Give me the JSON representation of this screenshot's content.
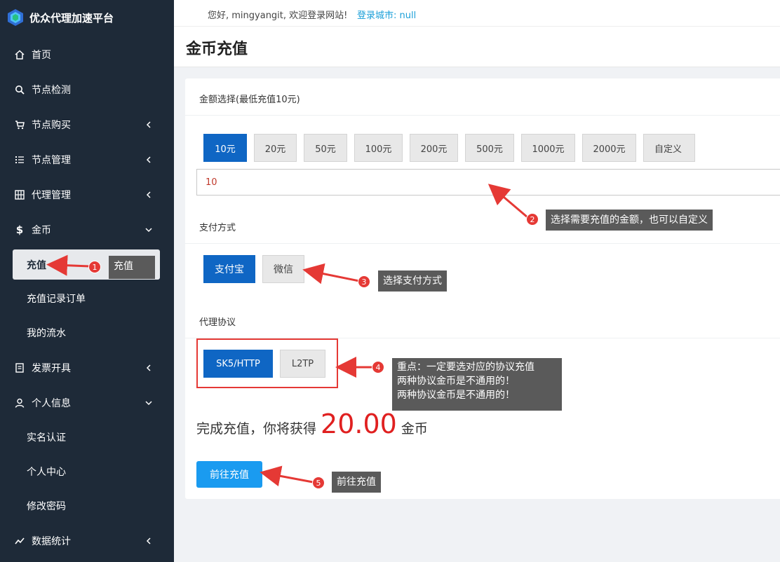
{
  "brand": {
    "title": "优众代理加速平台",
    "accent": "#1e2a38"
  },
  "sidebar": {
    "items": [
      {
        "label": "首页",
        "icon": "home-icon"
      },
      {
        "label": "节点检测",
        "icon": "search-icon"
      },
      {
        "label": "节点购买",
        "icon": "cart-icon"
      },
      {
        "label": "节点管理",
        "icon": "list-icon"
      },
      {
        "label": "代理管理",
        "icon": "grid-icon"
      },
      {
        "label": "金币",
        "icon": "dollar-icon"
      },
      {
        "label": "发票开具",
        "icon": "invoice-icon"
      },
      {
        "label": "个人信息",
        "icon": "user-icon"
      },
      {
        "label": "数据统计",
        "icon": "chart-icon"
      }
    ],
    "coin_sub": [
      "充值",
      "充值记录订单",
      "我的流水"
    ],
    "profile_sub": [
      "实名认证",
      "个人中心",
      "修改密码"
    ]
  },
  "topbar": {
    "greeting": "您好, mingyangit, 欢迎登录网站!",
    "city": "登录城市: null"
  },
  "page": {
    "title": "金币充值"
  },
  "amount": {
    "label": "金额选择(最低充值10元)",
    "options": [
      "10元",
      "20元",
      "50元",
      "100元",
      "200元",
      "500元",
      "1000元",
      "2000元",
      "自定义"
    ],
    "selected_index": 0,
    "input_value": "10"
  },
  "payment": {
    "label": "支付方式",
    "options": [
      "支付宝",
      "微信"
    ],
    "selected_index": 0
  },
  "protocol": {
    "label": "代理协议",
    "options": [
      "SK5/HTTP",
      "L2TP"
    ],
    "selected_index": 0
  },
  "summary": {
    "prefix": "完成充值，你将获得",
    "coins": "20.00",
    "suffix": "金币"
  },
  "submit": {
    "label": "前往充值"
  },
  "annotations": [
    {
      "num": "1",
      "text": "充值"
    },
    {
      "num": "2",
      "text": "选择需要充值的金额，也可以自定义"
    },
    {
      "num": "3",
      "text": "选择支付方式"
    },
    {
      "num": "4",
      "lines": [
        "重点：一定要选对应的协议充值",
        "两种协议金币是不通用的！",
        "两种协议金币是不通用的！"
      ]
    },
    {
      "num": "5",
      "text": "前往充值"
    }
  ],
  "colors": {
    "primary": "#0f66c4",
    "submit": "#1a9bf0",
    "highlight_red": "#e53935",
    "coin_red": "#e02020"
  }
}
